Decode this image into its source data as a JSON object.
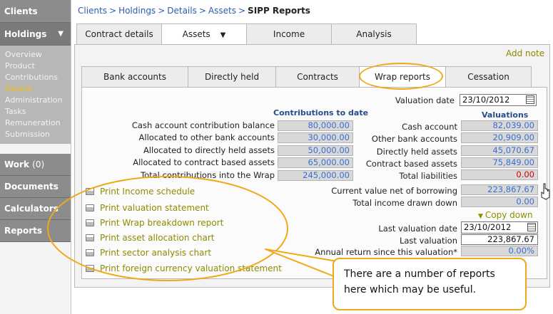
{
  "nav": {
    "clients": "Clients",
    "holdings": "Holdings",
    "holdings_items": [
      "Overview",
      "Product",
      "Contributions",
      "Details",
      "Administration",
      "Tasks",
      "Remuneration",
      "Submission"
    ],
    "work": "Work",
    "work_count": "(0)",
    "documents": "Documents",
    "calculators": "Calculators",
    "reports": "Reports"
  },
  "breadcrumb": [
    "Clients",
    "Holdings",
    "Details",
    "Assets",
    "SIPP Reports"
  ],
  "top_tabs": [
    "Contract details",
    "Assets",
    "Income",
    "Analysis"
  ],
  "add_note": "Add note",
  "inner_tabs": [
    "Bank accounts",
    "Directly held",
    "Contracts",
    "Wrap reports",
    "Cessation"
  ],
  "valuation_date_label": "Valuation date",
  "valuation_date": "23/10/2012",
  "contributions_header": "Contributions to date",
  "contributions": [
    {
      "label": "Cash account contribution balance",
      "value": "80,000.00"
    },
    {
      "label": "Allocated to other bank accounts",
      "value": "30,000.00"
    },
    {
      "label": "Allocated to directly held assets",
      "value": "50,000.00"
    },
    {
      "label": "Allocated to contract based assets",
      "value": "65,000.00"
    },
    {
      "label": "Total contributions into the Wrap",
      "value": "245,000.00"
    }
  ],
  "valuations_header": "Valuations",
  "valuations": [
    {
      "label": "Cash account",
      "value": "82,039.00"
    },
    {
      "label": "Other bank accounts",
      "value": "20,909.00"
    },
    {
      "label": "Directly held assets",
      "value": "45,070.67"
    },
    {
      "label": "Contract based assets",
      "value": "75,849.00"
    },
    {
      "label": "Total liabilities",
      "value": "0.00"
    }
  ],
  "net_borrowing_label": "Current value net of borrowing",
  "net_borrowing": "223,867.67",
  "income_drawn_label": "Total income drawn down",
  "income_drawn": "0.00",
  "copy_down": "Copy down",
  "last_valuation_date_label": "Last valuation date",
  "last_valuation_date": "23/10/2012",
  "last_valuation_label": "Last valuation",
  "last_valuation": "223,867.67",
  "annual_return_label": "Annual return since this valuation*",
  "annual_return": "0.00%",
  "print_links": [
    "Print Income schedule",
    "Print valuation statement",
    "Print Wrap breakdown report",
    "Print asset allocation chart",
    "Print sector analysis chart",
    "Print foreign currency valuation statement"
  ],
  "callout": "There are a number of reports here which may be useful.",
  "colors": {
    "highlight": "#f0a818",
    "link": "#2a5db0",
    "olive_link": "#8c8c00",
    "nav_bg": "#8c8c8c"
  }
}
